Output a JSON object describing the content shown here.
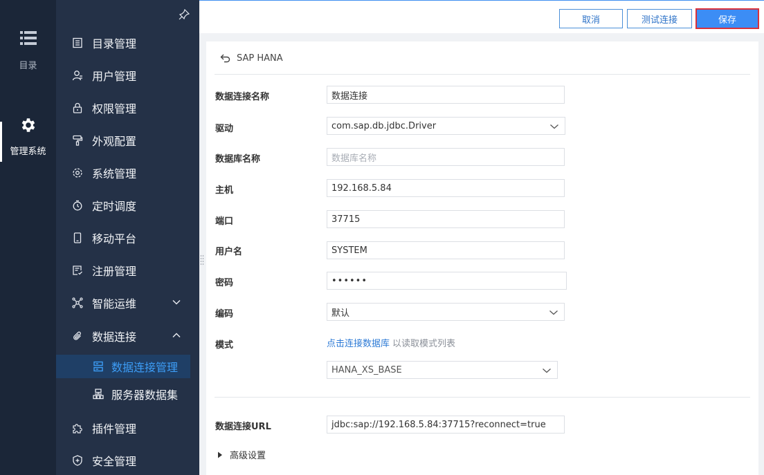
{
  "rail": {
    "catalog_label": "目录",
    "system_label": "管理系统"
  },
  "nav": {
    "items": [
      {
        "label": "目录管理"
      },
      {
        "label": "用户管理"
      },
      {
        "label": "权限管理"
      },
      {
        "label": "外观配置"
      },
      {
        "label": "系统管理"
      },
      {
        "label": "定时调度"
      },
      {
        "label": "移动平台"
      },
      {
        "label": "注册管理"
      },
      {
        "label": "智能运维"
      },
      {
        "label": "数据连接"
      },
      {
        "label": "插件管理"
      },
      {
        "label": "安全管理"
      }
    ],
    "sub_items": [
      {
        "label": "数据连接管理"
      },
      {
        "label": "服务器数据集"
      }
    ]
  },
  "toolbar": {
    "cancel_label": "取消",
    "test_label": "测试连接",
    "save_label": "保存"
  },
  "panel": {
    "back_label": "SAP HANA",
    "fields": {
      "conn_name": {
        "label": "数据连接名称",
        "value": "数据连接"
      },
      "driver": {
        "label": "驱动",
        "value": "com.sap.db.jdbc.Driver"
      },
      "db_name": {
        "label": "数据库名称",
        "placeholder": "数据库名称"
      },
      "host": {
        "label": "主机",
        "value": "192.168.5.84"
      },
      "port": {
        "label": "端口",
        "value": "37715"
      },
      "username": {
        "label": "用户名",
        "value": "SYSTEM"
      },
      "password": {
        "label": "密码",
        "value": "••••••"
      },
      "encoding": {
        "label": "编码",
        "value": "默认"
      },
      "schema": {
        "label": "模式",
        "link": "点击连接数据库",
        "hint": "以读取模式列表",
        "value": "HANA_XS_BASE"
      },
      "url": {
        "label": "数据连接URL",
        "value": "jdbc:sap://192.168.5.84:37715?reconnect=true"
      }
    },
    "advanced_label": "高级设置"
  },
  "colors": {
    "rail_bg": "#1b2638",
    "nav_bg": "#243147",
    "active_sub_bg": "#1f3f66",
    "accent": "#3d9df6",
    "save_bg": "#3c8df5",
    "save_border": "#d9303a"
  }
}
